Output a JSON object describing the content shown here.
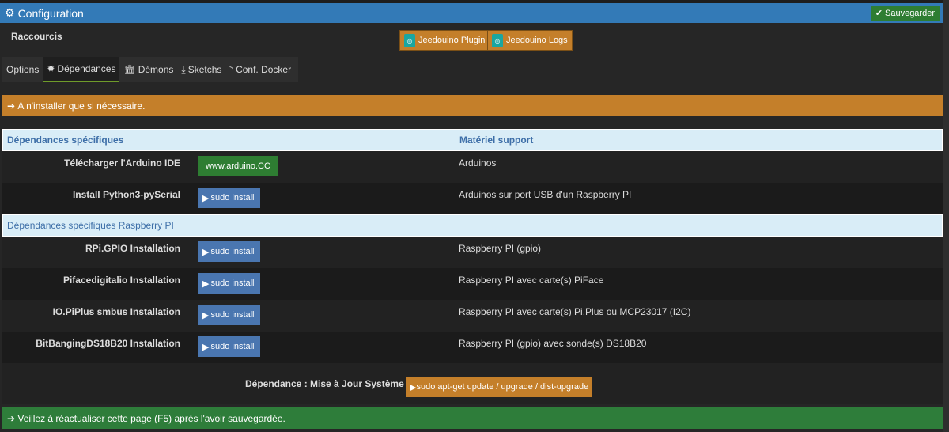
{
  "header": {
    "title": "Configuration",
    "icon": "gears-icon",
    "save_label": "Sauvegarder"
  },
  "shortcuts": {
    "label": "Raccourcis",
    "buttons": [
      "Jeedouino Plugin",
      "Jeedouino Logs"
    ]
  },
  "tabs": [
    {
      "label": "Options"
    },
    {
      "label": "Dépendances",
      "icon": "cog-icon",
      "active": true
    },
    {
      "label": "Démons",
      "icon": "bank-icon"
    },
    {
      "label": "Sketchs",
      "icon": "download-icon"
    },
    {
      "label": "Conf. Docker",
      "icon": "rss-icon"
    }
  ],
  "alert_top": "A n'installer que si nécessaire.",
  "table": {
    "header": {
      "col1": "Dépendances spécifiques",
      "col2": "Matériel support"
    },
    "rows": [
      {
        "label": "Télécharger l'Arduino IDE",
        "button": "www.arduino.CC",
        "desc": "Arduinos"
      },
      {
        "label": "Install Python3-pySerial",
        "button": "sudo install",
        "desc": "Arduinos sur port USB d'un Raspberry PI"
      }
    ],
    "section2": "Dépendances spécifiques Raspberry PI",
    "rows2": [
      {
        "label": "RPi.GPIO Installation",
        "button": "sudo install",
        "desc": "Raspberry PI (gpio)"
      },
      {
        "label": "Pifacedigitalio Installation",
        "button": "sudo install",
        "desc": "Raspberry PI avec carte(s) PiFace"
      },
      {
        "label": "IO.PiPlus smbus Installation",
        "button": "sudo install",
        "desc": "Raspberry PI avec carte(s) Pi.Plus ou MCP23017 (I2C)"
      },
      {
        "label": "BitBangingDS18B20 Installation",
        "button": "sudo install",
        "desc": "Raspberry PI (gpio) avec sonde(s) DS18B20"
      }
    ]
  },
  "update": {
    "label": "Dépendance : Mise à Jour Système",
    "button": "sudo apt-get update / upgrade / dist-upgrade"
  },
  "alert_bottom": "Veillez à réactualiser cette page (F5) après l'avoir sauvegardée."
}
